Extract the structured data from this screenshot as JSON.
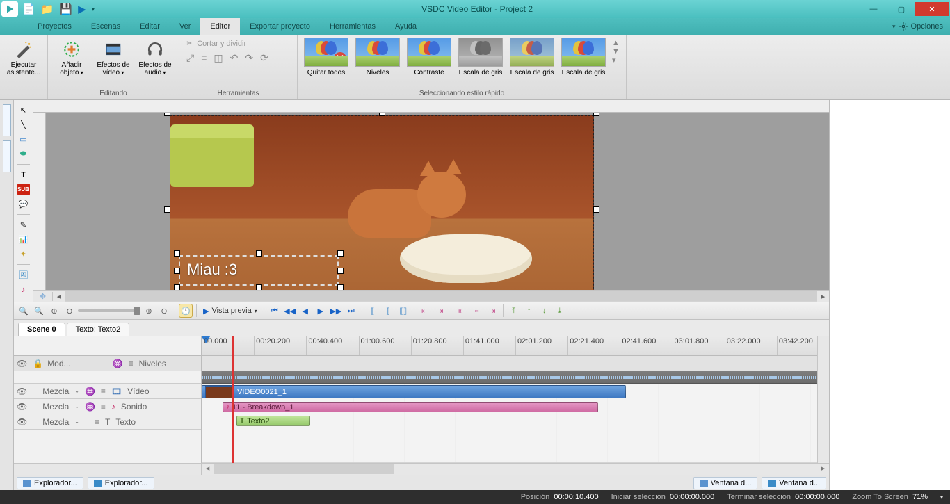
{
  "app": {
    "title": "VSDC Video Editor - Project 2"
  },
  "menus": {
    "proyectos": "Proyectos",
    "escenas": "Escenas",
    "editar": "Editar",
    "ver": "Ver",
    "editor": "Editor",
    "exportar": "Exportar proyecto",
    "herramientas": "Herramientas",
    "ayuda": "Ayuda",
    "opciones": "Opciones"
  },
  "ribbon": {
    "ejecutar": "Ejecutar asistente...",
    "anadir": "Añadir objeto",
    "efectos_video": "Efectos de vídeo",
    "efectos_audio": "Efectos de audio",
    "editando": "Editando",
    "cortar": "Cortar y dividir",
    "herramientas": "Herramientas",
    "styles": [
      "Quitar todos",
      "Niveles",
      "Contraste",
      "Escala de gris",
      "Escala de gris",
      "Escala de gris"
    ],
    "style_caption": "Seleccionando estilo rápido"
  },
  "canvas": {
    "text_overlay": "Miau :3"
  },
  "vista": "Vista previa",
  "tabs": {
    "scene": "Scene 0",
    "texto": "Texto: Texto2"
  },
  "timeline": {
    "ticks": [
      "00.000",
      "00:20.200",
      "00:40.400",
      "01:00.600",
      "01:20.800",
      "01:41.000",
      "02:01.200",
      "02:21.400",
      "02:41.600",
      "03:01.800",
      "03:22.000",
      "03:42.200"
    ],
    "header_mode": "Mod...",
    "header_niveles": "Niveles",
    "tracks": [
      {
        "mix": "Mezcla",
        "name": "Vídeo",
        "clip": "VIDEO0021_1"
      },
      {
        "mix": "Mezcla",
        "name": "Sonido",
        "clip": "11 - Breakdown_1"
      },
      {
        "mix": "Mezcla",
        "name": "Texto",
        "clip": "Texto2"
      }
    ]
  },
  "panels": {
    "exp1": "Explorador...",
    "exp2": "Explorador...",
    "vent1": "Ventana d...",
    "vent2": "Ventana d..."
  },
  "status": {
    "pos_lbl": "Posición",
    "pos": "00:00:10.400",
    "ini_lbl": "Iniciar selección",
    "ini": "00:00:00.000",
    "fin_lbl": "Terminar selección",
    "fin": "00:00:00.000",
    "zoom_lbl": "Zoom To Screen",
    "zoom": "71%"
  }
}
